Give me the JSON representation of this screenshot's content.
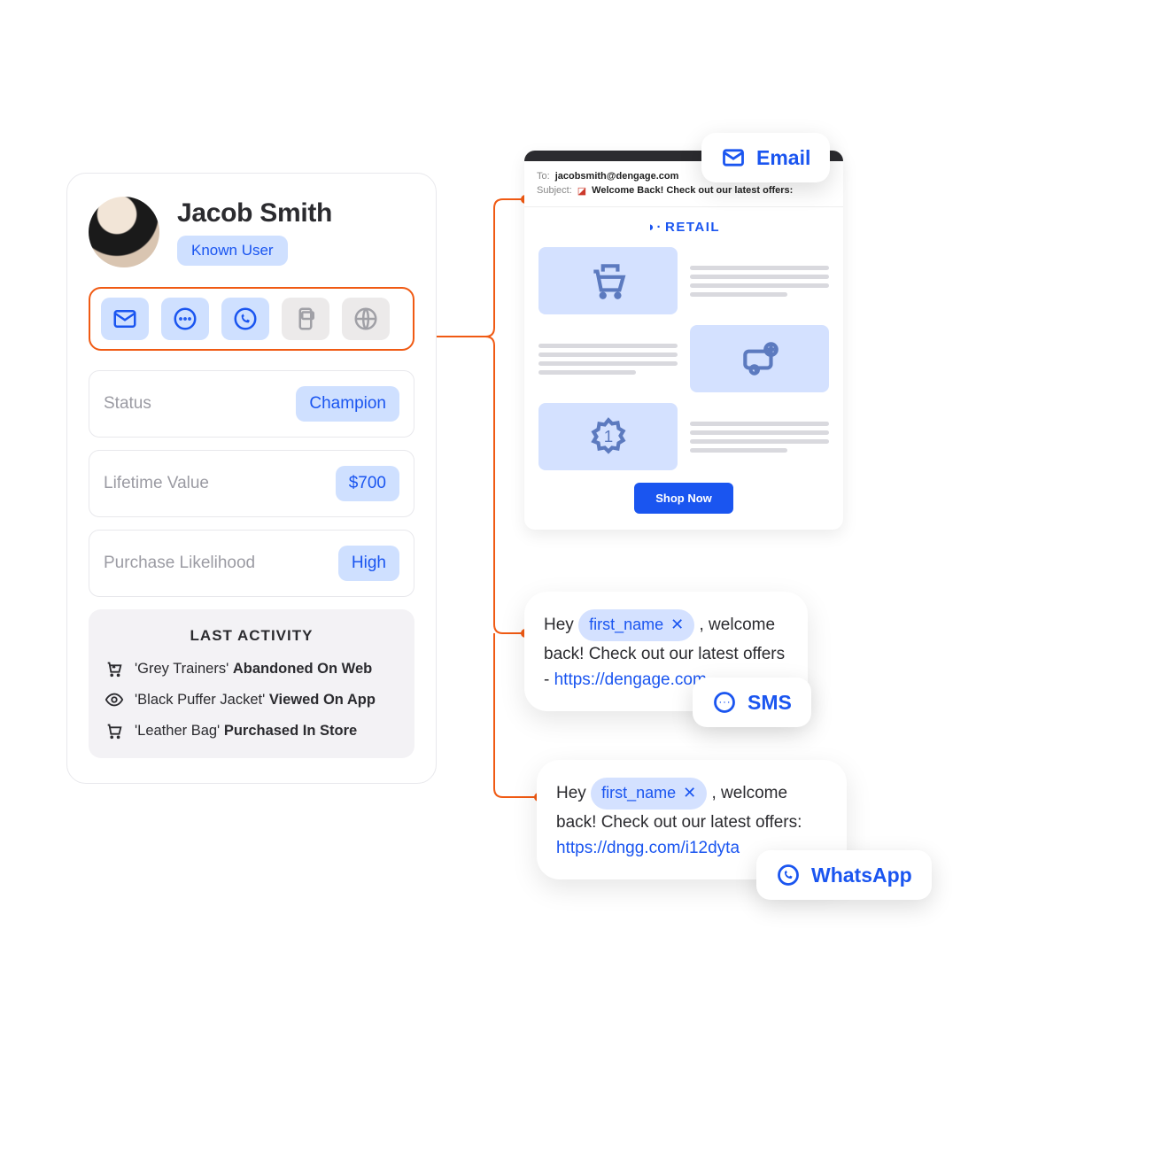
{
  "profile": {
    "name": "Jacob Smith",
    "known_label": "Known User",
    "channels": [
      {
        "key": "email",
        "active": true
      },
      {
        "key": "sms",
        "active": true
      },
      {
        "key": "whatsapp",
        "active": true
      },
      {
        "key": "inapp",
        "active": false
      },
      {
        "key": "web",
        "active": false
      }
    ],
    "stats": [
      {
        "label": "Status",
        "value": "Champion"
      },
      {
        "label": "Lifetime Value",
        "value": "$700"
      },
      {
        "label": "Purchase Likelihood",
        "value": "High"
      }
    ],
    "activity_title": "LAST ACTIVITY",
    "activity": [
      {
        "icon": "cart-x",
        "product": "'Grey Trainers'",
        "action": "Abandoned On Web"
      },
      {
        "icon": "eye",
        "product": "'Black Puffer Jacket'",
        "action": "Viewed On App"
      },
      {
        "icon": "cart",
        "product": "'Leather Bag'",
        "action": "Purchased In Store"
      }
    ]
  },
  "tags": {
    "email": "Email",
    "sms": "SMS",
    "whatsapp": "WhatsApp"
  },
  "email_preview": {
    "to_label": "To:",
    "to_value": "jacobsmith@dengage.com",
    "subject_label": "Subject:",
    "subject_value": "Welcome Back! Check out our latest offers:",
    "brand": "RETAIL",
    "cta": "Shop Now"
  },
  "sms_message": {
    "prefix": "Hey ",
    "variable": "first_name",
    "body1": " , welcome back! Check out our latest offers - ",
    "link": "https://dengage.com"
  },
  "whatsapp_message": {
    "prefix": "Hey ",
    "variable": "first_name",
    "body1": " , welcome back! Check out our latest offers: ",
    "link": "https://dngg.com/i12dyta"
  }
}
